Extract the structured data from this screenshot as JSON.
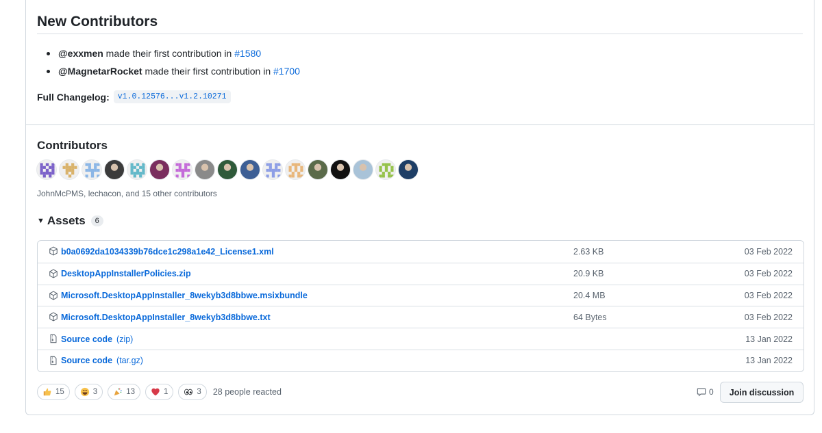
{
  "new_contributors": {
    "title": "New Contributors",
    "items": [
      {
        "user": "@exxmen",
        "text": " made their first contribution in ",
        "pr": "#1580"
      },
      {
        "user": "@MagnetarRocket",
        "text": " made their first contribution in ",
        "pr": "#1700"
      }
    ],
    "changelog_label": "Full Changelog:",
    "changelog_range": "v1.0.12576...v1.2.10271"
  },
  "contributors": {
    "title": "Contributors",
    "avatars": [
      {
        "name": "identicon-purple",
        "color": "#7b61c9"
      },
      {
        "name": "identicon-tan",
        "color": "#d9b26a"
      },
      {
        "name": "identicon-blue",
        "color": "#8bb6e6"
      },
      {
        "name": "photo-avatar",
        "color": "#3b3b3b"
      },
      {
        "name": "identicon-teal",
        "color": "#62b8c9"
      },
      {
        "name": "photo-avatar",
        "color": "#7a2e5e"
      },
      {
        "name": "identicon-violet",
        "color": "#c46ad9"
      },
      {
        "name": "photo-avatar",
        "color": "#8a8a8a"
      },
      {
        "name": "photo-avatar",
        "color": "#2f5a3a"
      },
      {
        "name": "photo-avatar",
        "color": "#3d5f95"
      },
      {
        "name": "identicon-periwinkle",
        "color": "#8d9ee6"
      },
      {
        "name": "identicon-peach",
        "color": "#e8b67a"
      },
      {
        "name": "photo-avatar",
        "color": "#5b6b4a"
      },
      {
        "name": "photo-avatar",
        "color": "#111111"
      },
      {
        "name": "photo-avatar",
        "color": "#a9c3d8"
      },
      {
        "name": "identicon-green",
        "color": "#95c24a"
      },
      {
        "name": "photo-avatar",
        "color": "#1e3e66"
      }
    ],
    "summary": "JohnMcPMS, lechacon, and 15 other contributors"
  },
  "assets": {
    "title": "Assets",
    "count": "6",
    "rows": [
      {
        "icon": "package-icon",
        "name": "b0a0692da1034339b76dce1c298a1e42_License1.xml",
        "sub": "",
        "size": "2.63 KB",
        "date": "03 Feb 2022"
      },
      {
        "icon": "package-icon",
        "name": "DesktopAppInstallerPolicies.zip",
        "sub": "",
        "size": "20.9 KB",
        "date": "03 Feb 2022"
      },
      {
        "icon": "package-icon",
        "name": "Microsoft.DesktopAppInstaller_8wekyb3d8bbwe.msixbundle",
        "sub": "",
        "size": "20.4 MB",
        "date": "03 Feb 2022"
      },
      {
        "icon": "package-icon",
        "name": "Microsoft.DesktopAppInstaller_8wekyb3d8bbwe.txt",
        "sub": "",
        "size": "64 Bytes",
        "date": "03 Feb 2022"
      },
      {
        "icon": "file-zip-icon",
        "name": "Source code",
        "sub": "(zip)",
        "size": "",
        "date": "13 Jan 2022"
      },
      {
        "icon": "file-zip-icon",
        "name": "Source code",
        "sub": "(tar.gz)",
        "size": "",
        "date": "13 Jan 2022"
      }
    ]
  },
  "reactions": {
    "items": [
      {
        "emoji": "thumbs-up",
        "count": "15"
      },
      {
        "emoji": "laugh",
        "count": "3"
      },
      {
        "emoji": "hooray",
        "count": "13"
      },
      {
        "emoji": "heart",
        "count": "1"
      },
      {
        "emoji": "eyes",
        "count": "3"
      }
    ],
    "summary": "28 people reacted"
  },
  "discussion": {
    "comment_count": "0",
    "join_label": "Join discussion"
  }
}
